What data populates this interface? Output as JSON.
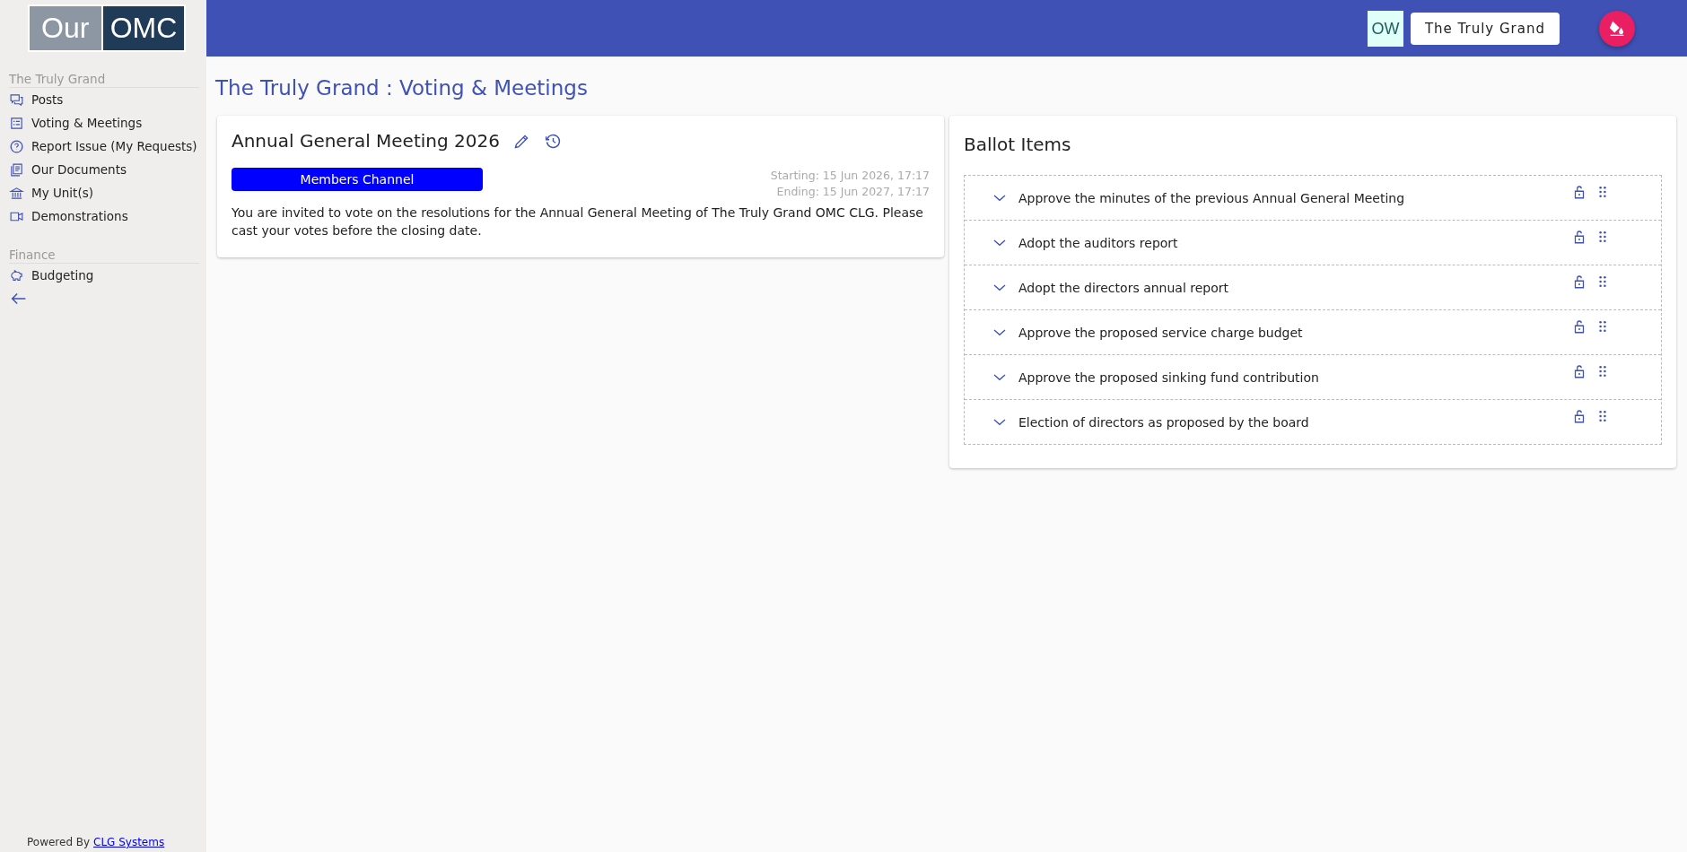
{
  "logo": {
    "left": "Our",
    "right": "OMC"
  },
  "sidebar": {
    "sections": [
      {
        "title": "The Truly Grand",
        "items": [
          {
            "label": "Posts"
          },
          {
            "label": "Voting & Meetings"
          },
          {
            "label": "Report Issue (My Requests)"
          },
          {
            "label": "Our Documents"
          },
          {
            "label": "My Unit(s)"
          },
          {
            "label": "Demonstrations"
          }
        ]
      },
      {
        "title": "Finance",
        "items": [
          {
            "label": "Budgeting"
          }
        ]
      }
    ],
    "footer": {
      "prefix": "Powered By",
      "link": "CLG Systems"
    }
  },
  "topbar": {
    "initials": "OW",
    "org_button": "The Truly Grand"
  },
  "page_title": "The Truly Grand : Voting & Meetings",
  "meeting": {
    "title": "Annual General Meeting 2026",
    "channel": "Members Channel",
    "starting": "Starting: 15 Jun 2026, 17:17",
    "ending": "Ending: 15 Jun 2027, 17:17",
    "description": "You are invited to vote on the resolutions for the Annual General Meeting of The Truly Grand OMC CLG. Please cast your votes before the closing date."
  },
  "ballot": {
    "title": "Ballot Items",
    "items": [
      {
        "label": "Approve the minutes of the previous Annual General Meeting",
        "expanded": false
      },
      {
        "label": "Adopt the auditors report",
        "expanded": false
      },
      {
        "label": "Adopt the directors annual report",
        "expanded": false
      },
      {
        "label": "Approve the proposed service charge budget",
        "expanded": false
      },
      {
        "label": "Approve the proposed sinking fund contribution",
        "expanded": false
      },
      {
        "label": "Election of directors as proposed by the board",
        "expanded": false
      }
    ]
  }
}
